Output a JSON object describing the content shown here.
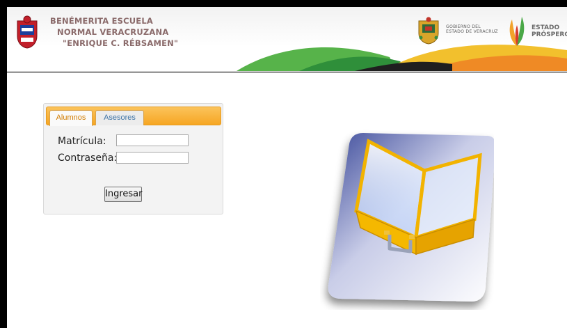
{
  "header": {
    "school_name_line1": "BENÉMERITA ESCUELA",
    "school_name_line2": "NORMAL VERACRUZANA",
    "school_name_line3": "\"ENRIQUE C. RÉBSAMEN\"",
    "gov_line1": "GOBIERNO DEL",
    "gov_line2": "ESTADO DE VERACRUZ",
    "brand_line1": "ESTADO",
    "brand_line2": "PRÓSPERO"
  },
  "login": {
    "tabs": [
      {
        "label": "Alumnos",
        "active": true
      },
      {
        "label": "Asesores",
        "active": false
      }
    ],
    "matricula_label": "Matrícula:",
    "matricula_value": "",
    "contrasena_label": "Contraseña:",
    "contrasena_value": "",
    "submit_label": "Ingresar"
  },
  "colors": {
    "tab_bar": "#f6a623",
    "active_tab_text": "#d17c00",
    "inactive_tab_text": "#3f74a6",
    "swoosh_green": "#4caf50",
    "swoosh_orange": "#f08a24",
    "case_yellow": "#f5b800"
  },
  "icons": {
    "school_logo": "school-crest-icon",
    "gov_shield": "veracruz-shield-icon",
    "brand_mark": "estado-prospero-icon",
    "illustration": "briefcase-icon"
  }
}
